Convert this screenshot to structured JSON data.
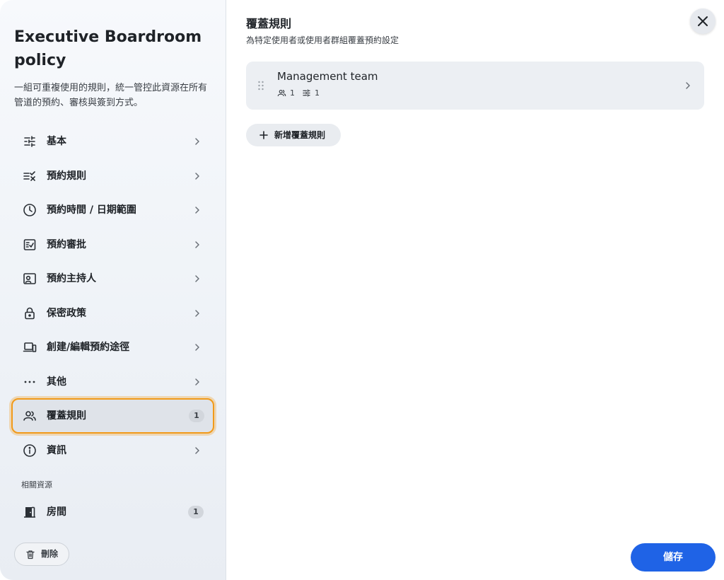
{
  "sidebar": {
    "title": "Executive Boardroom policy",
    "description": "一組可重複使用的規則，統一管控此資源在所有管道的預約、審核與簽到方式。",
    "items": [
      {
        "label": "基本",
        "icon": "sliders-icon"
      },
      {
        "label": "預約規則",
        "icon": "checklist-icon"
      },
      {
        "label": "預約時間 / 日期範圍",
        "icon": "clock-icon"
      },
      {
        "label": "預約審批",
        "icon": "approval-icon"
      },
      {
        "label": "預約主持人",
        "icon": "host-icon"
      },
      {
        "label": "保密政策",
        "icon": "lock-icon"
      },
      {
        "label": "創建/編輯預約途徑",
        "icon": "devices-icon"
      },
      {
        "label": "其他",
        "icon": "more-icon"
      },
      {
        "label": "覆蓋規則",
        "icon": "users-icon",
        "badge": "1",
        "active": true
      },
      {
        "label": "資訊",
        "icon": "info-icon"
      }
    ],
    "related_section_label": "相關資源",
    "related_items": [
      {
        "label": "房間",
        "icon": "door-icon",
        "badge": "1"
      }
    ],
    "delete_label": "刪除"
  },
  "main": {
    "title": "覆蓋規則",
    "subtitle": "為特定使用者或使用者群組覆蓋預約設定",
    "rules": [
      {
        "name": "Management team",
        "users_count": "1",
        "settings_count": "1"
      }
    ],
    "add_rule_label": "新增覆蓋規則",
    "save_label": "儲存"
  },
  "colors": {
    "accent": "#1f63e6",
    "active_outline": "#f19a1a",
    "sidebar_bg": "#eef2f7",
    "card_bg": "#eceff3"
  }
}
